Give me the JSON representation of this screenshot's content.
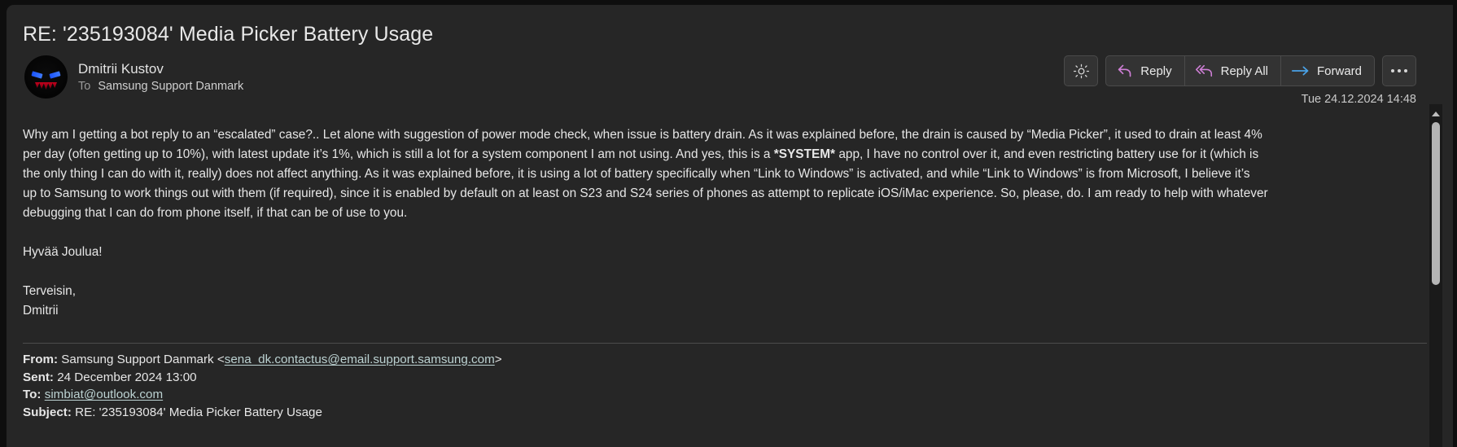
{
  "theme": {
    "pane_bg": "#262626",
    "page_bg": "#0e0e0e",
    "text": "#e6e6e6",
    "muted": "#9a9a9a",
    "reply_accent": "#cf7fd6",
    "forward_accent": "#4aa3e8",
    "link": "#bcd2d2",
    "divider": "#4c4c4c"
  },
  "header": {
    "subject": "RE: '235193084' Media Picker Battery Usage",
    "sender_name": "Dmitrii Kustov",
    "recipient_label": "To",
    "recipient_value": "Samsung Support Danmark",
    "timestamp": "Tue 24.12.2024 14:48",
    "avatar_alt": "dark-face-avatar"
  },
  "toolbar": {
    "brightness_icon": "sun-icon",
    "reply_label": "Reply",
    "reply_icon": "reply-arrow-icon",
    "reply_all_label": "Reply All",
    "reply_all_icon": "reply-all-arrow-icon",
    "forward_label": "Forward",
    "forward_icon": "forward-arrow-icon",
    "more_label": "more-options-icon"
  },
  "body": {
    "lines": [
      {
        "type": "text",
        "segments": [
          {
            "text": "Why am I getting a bot reply to an “escalated” case?.. Let alone with suggestion of power mode check, when issue is battery drain. As it was explained before, the drain is caused by “Media Picker”, it used to drain at least 4%",
            "bold": false
          }
        ]
      },
      {
        "type": "text",
        "segments": [
          {
            "text": "per day (often getting up to 10%), with latest update it’s 1%, which is still a lot for a system component I am not using. And yes, this is a ",
            "bold": false
          },
          {
            "text": "*SYSTEM*",
            "bold": true
          },
          {
            "text": " app, I have no control over it, and even restricting battery use for it (which is",
            "bold": false
          }
        ]
      },
      {
        "type": "text",
        "segments": [
          {
            "text": "the only thing I can do with it, really) does not affect anything. As it was explained before, it is using a lot of battery specifically when “Link to Windows” is activated, and while “Link to Windows” is from Microsoft, I believe it’s",
            "bold": false
          }
        ]
      },
      {
        "type": "text",
        "segments": [
          {
            "text": "up to Samsung to work things out with them (if required), since it is enabled by default on at least on S23 and S24 series of phones as attempt to replicate iOS/iMac experience. So, please, do. I am ready to help with whatever",
            "bold": false
          }
        ]
      },
      {
        "type": "text",
        "segments": [
          {
            "text": "debugging that I can do from phone itself, if that can be of use to you.",
            "bold": false
          }
        ]
      },
      {
        "type": "blank"
      },
      {
        "type": "text",
        "segments": [
          {
            "text": "Hyvää Joulua!",
            "bold": false
          }
        ]
      },
      {
        "type": "blank"
      },
      {
        "type": "text",
        "segments": [
          {
            "text": "Terveisin,",
            "bold": false
          }
        ]
      },
      {
        "type": "text",
        "segments": [
          {
            "text": "Dmitrii",
            "bold": false
          }
        ]
      }
    ]
  },
  "quoted_header": {
    "rows": [
      {
        "label": "From:",
        "parts": [
          {
            "text": " Samsung Support Danmark <",
            "link": false
          },
          {
            "text": "sena_dk.contactus@email.support.samsung.com",
            "link": true
          },
          {
            "text": ">",
            "link": false
          }
        ]
      },
      {
        "label": "Sent:",
        "parts": [
          {
            "text": " 24 December 2024 13:00",
            "link": false
          }
        ]
      },
      {
        "label": "To:",
        "parts": [
          {
            "text": " ",
            "link": false
          },
          {
            "text": "simbiat@outlook.com",
            "link": true
          }
        ]
      },
      {
        "label": "Subject:",
        "parts": [
          {
            "text": " RE: '235193084' Media Picker Battery Usage",
            "link": false
          }
        ]
      }
    ]
  },
  "scrollbar": {
    "up_arrow": "scroll-up-arrow-icon",
    "thumb": "scroll-thumb"
  }
}
